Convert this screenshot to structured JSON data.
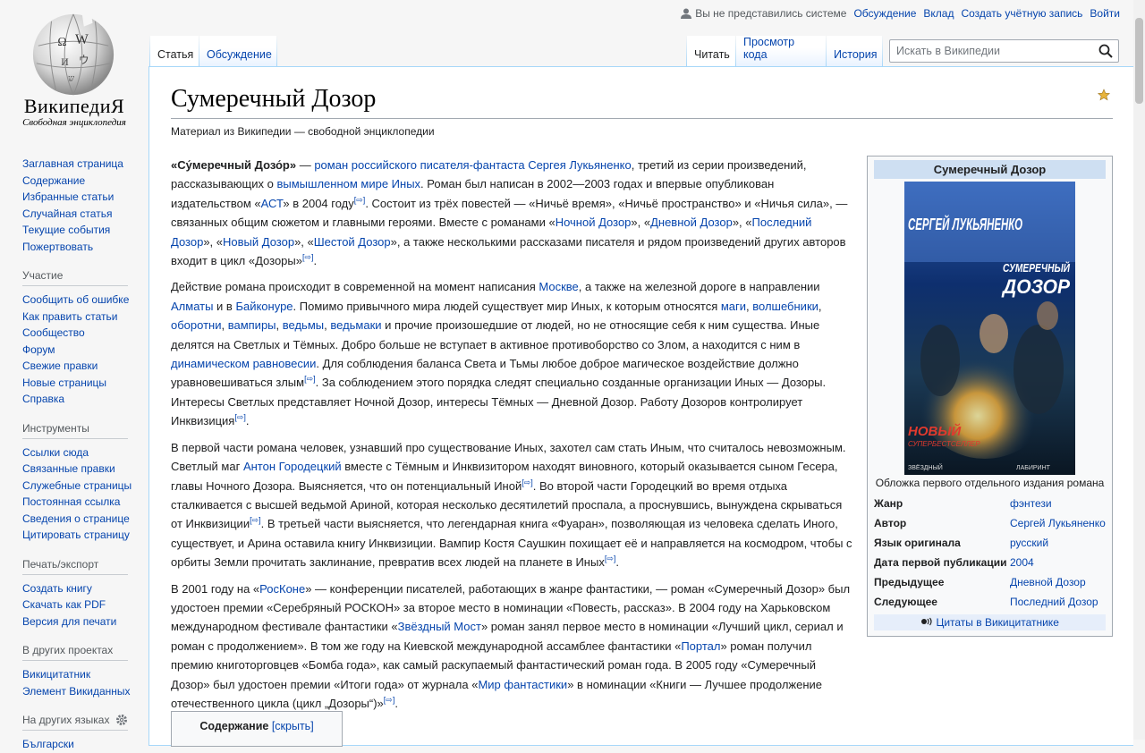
{
  "logo": {
    "wordmark": "ВикипедиЯ",
    "tagline": "Свободная энциклопедия"
  },
  "personal": {
    "status": "Вы не представились системе",
    "links": [
      "Обсуждение",
      "Вклад",
      "Создать учётную запись",
      "Войти"
    ]
  },
  "tabs": {
    "left": [
      {
        "label": "Статья",
        "selected": true
      },
      {
        "label": "Обсуждение",
        "selected": false
      }
    ],
    "right": [
      {
        "label": "Читать",
        "selected": true
      },
      {
        "label": "Просмотр кода",
        "selected": false
      },
      {
        "label": "История",
        "selected": false
      }
    ]
  },
  "search": {
    "placeholder": "Искать в Википедии"
  },
  "sidebar": {
    "nav": [
      "Заглавная страница",
      "Содержание",
      "Избранные статьи",
      "Случайная статья",
      "Текущие события",
      "Пожертвовать"
    ],
    "participation": {
      "title": "Участие",
      "items": [
        "Сообщить об ошибке",
        "Как править статьи",
        "Сообщество",
        "Форум",
        "Свежие правки",
        "Новые страницы",
        "Справка"
      ]
    },
    "tools": {
      "title": "Инструменты",
      "items": [
        "Ссылки сюда",
        "Связанные правки",
        "Служебные страницы",
        "Постоянная ссылка",
        "Сведения о странице",
        "Цитировать страницу"
      ]
    },
    "print": {
      "title": "Печать/экспорт",
      "items": [
        "Создать книгу",
        "Скачать как PDF",
        "Версия для печати"
      ]
    },
    "projects": {
      "title": "В других проектах",
      "items": [
        "Викицитатник",
        "Элемент Викиданных"
      ]
    },
    "languages": {
      "title": "На других языках",
      "items": [
        "Български"
      ]
    }
  },
  "article": {
    "title": "Сумеречный Дозор",
    "sitesub": "Материал из Википедии — свободной энциклопедии",
    "ref": "[⇨]",
    "p1": {
      "bold": "«Су́меречный Дозо́р»",
      "t1": " — ",
      "l1": "роман российского писателя-фантаста Сергея Лукьяненко",
      "t2": ", третий из серии произведений, рассказывающих о ",
      "l2": "вымышленном мире Иных",
      "t3": ". Роман был написан в 2002—2003 годах и впервые опубликован издательством «",
      "l3": "АСТ",
      "t4": "» в 2004 году",
      "t5": ". Состоит из трёх повестей — «Ничьё время», «Ничьё пространство» и «Ничья сила», — связанных общим сюжетом и главными героями. Вместе с романами «",
      "l4": "Ночной Дозор",
      "t6": "», «",
      "l5": "Дневной Дозор",
      "t7": "», «",
      "l6": "Последний Дозор",
      "t8": "», «",
      "l7": "Новый Дозор",
      "t9": "», «",
      "l8": "Шестой Дозор",
      "t10": "», а также несколькими рассказами писателя и рядом произведений других авторов входит в цикл «Дозоры»"
    },
    "p2": {
      "t1": "Действие романа происходит в современной на момент написания ",
      "l1": "Москве",
      "t2": ", а также на железной дороге в направлении ",
      "l2": "Алматы",
      "t3": " и в ",
      "l3": "Байконуре",
      "t4": ". Помимо привычного мира людей существует мир Иных, к которым относятся ",
      "l4": "маги",
      "t5": ", ",
      "l5": "волшебники",
      "t6": ", ",
      "l6": "оборотни",
      "t7": ", ",
      "l7": "вампиры",
      "t8": ", ",
      "l8": "ведьмы",
      "t9": ", ",
      "l9": "ведьмаки",
      "t10": " и прочие произошедшие от людей, но не относящие себя к ним существа. Иные делятся на Светлых и Тёмных. Добро больше не вступает в активное противоборство со Злом, а находится с ним в ",
      "l10": "динамическом равновесии",
      "t11": ". Для соблюдения баланса Света и Тьмы любое доброе магическое воздействие должно уравновешиваться злым",
      "t12": ". За соблюдением этого порядка следят специально созданные организации Иных — Дозоры. Интересы Светлых представляет Ночной Дозор, интересы Тёмных — Дневной Дозор. Работу Дозоров контролирует Инквизиция",
      "t13": "."
    },
    "p3": {
      "t1": "В первой части романа человек, узнавший про существование Иных, захотел сам стать Иным, что считалось невозможным. Светлый маг ",
      "l1": "Антон Городецкий",
      "t2": " вместе с Тёмным и Инквизитором находят виновного, который оказывается сыном Гесера, главы Ночного Дозора. Выясняется, что он потенциальный Иной",
      "t3": ". Во второй части Городецкий во время отдыха сталкивается с высшей ведьмой Ариной, которая несколько десятилетий проспала, а проснувшись, вынуждена скрываться от Инквизиции",
      "t4": ". В третьей части выясняется, что легендарная книга «Фуаран», позволяющая из человека сделать Иного, существует, и Арина оставила книгу Инквизиции. Вампир Костя Саушкин похищает её и направляется на космодром, чтобы с орбиты Земли прочитать заклинание, превратив всех людей на планете в Иных",
      "t5": "."
    },
    "p4": {
      "t1": "В 2001 году на «",
      "l1": "РосКоне",
      "t2": "» — конференции писателей, работающих в жанре фантастики, — роман «Сумеречный Дозор» был удостоен премии «Серебряный РОСКОН» за второе место в номинации «Повесть, рассказ». В 2004 году на Харьковском международном фестивале фантастики «",
      "l2": "Звёздный Мост",
      "t3": "» роман занял первое место в номинации «Лучший цикл, сериал и роман с продолжением». В том же году на Киевской международной ассамблее фантастики «",
      "l3": "Портал",
      "t4": "» роман получил премию книготорговцев «Бомба года», как самый раскупаемый фантастический роман года. В 2005 году «Сумеречный Дозор» был удостоен премии «Итоги года» от журнала «",
      "l4": "Мир фантастики",
      "t5": "» в номинации «Книги — Лучшее продолжение отечественного цикла (цикл „Дозоры“)»",
      "t6": "."
    }
  },
  "toc": {
    "title": "Содержание",
    "toggle": "[скрыть]"
  },
  "infobox": {
    "title": "Сумеречный Дозор",
    "cover": {
      "author": "СЕРГЕЙ ЛУКЬЯНЕНКО",
      "title1": "СУМЕРЕЧНЫЙ",
      "title2": "ДОЗОР",
      "badge1": "НОВЫЙ",
      "badge2": "СУПЕРБЕСТСЕЛЛЕР",
      "series": "ЗВЁЗДНЫЙ",
      "publisher": "ЛАБИРИНТ"
    },
    "caption": "Обложка первого отдельного издания романа",
    "rows": [
      {
        "label": "Жанр",
        "value": "фэнтези"
      },
      {
        "label": "Автор",
        "value": "Сергей Лукьяненко"
      },
      {
        "label": "Язык оригинала",
        "value": "русский"
      },
      {
        "label": "Дата первой публикации",
        "value": "2004"
      },
      {
        "label": "Предыдущее",
        "value": "Дневной Дозор"
      },
      {
        "label": "Следующее",
        "value": "Последний Дозор"
      }
    ],
    "quotes": "Цитаты в Викицитатнике"
  }
}
